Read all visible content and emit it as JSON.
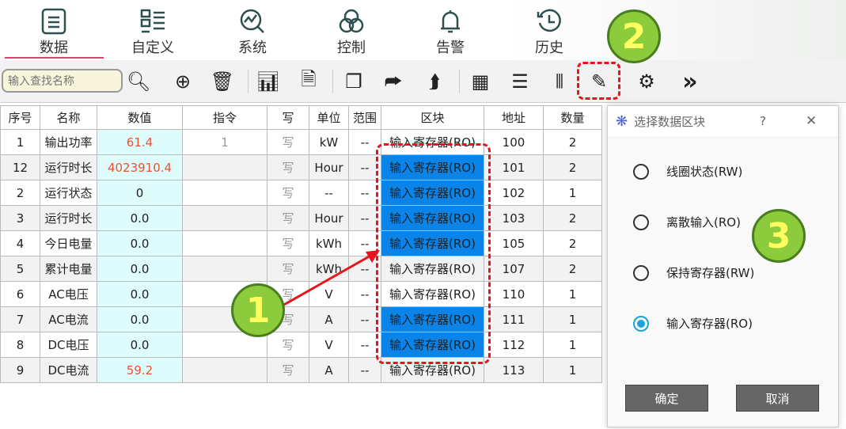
{
  "nav": [
    {
      "label": "数据",
      "icon": "document-icon"
    },
    {
      "label": "自定义",
      "icon": "list-icon"
    },
    {
      "label": "系统",
      "icon": "chart-search-icon"
    },
    {
      "label": "控制",
      "icon": "control-icon"
    },
    {
      "label": "告警",
      "icon": "bell-icon"
    },
    {
      "label": "历史",
      "icon": "history-icon"
    }
  ],
  "search": {
    "placeholder": "输入查找名称"
  },
  "table": {
    "headers": [
      "序号",
      "名称",
      "数值",
      "指令",
      "写",
      "单位",
      "范围",
      "区块",
      "地址",
      "数量"
    ],
    "rows": [
      [
        "1",
        "输出功率",
        "61.4",
        "1",
        "写",
        "kW",
        "--",
        "输入寄存器(RO)",
        "100",
        "2"
      ],
      [
        "12",
        "运行时长",
        "4023910.4",
        "",
        "写",
        "Hour",
        "--",
        "输入寄存器(RO)",
        "101",
        "2"
      ],
      [
        "2",
        "运行状态",
        "0",
        "",
        "写",
        "--",
        "--",
        "输入寄存器(RO)",
        "102",
        "1"
      ],
      [
        "3",
        "运行时长",
        "0.0",
        "",
        "写",
        "Hour",
        "--",
        "输入寄存器(RO)",
        "103",
        "2"
      ],
      [
        "4",
        "今日电量",
        "0.0",
        "",
        "写",
        "kWh",
        "--",
        "输入寄存器(RO)",
        "105",
        "2"
      ],
      [
        "5",
        "累计电量",
        "0.0",
        "",
        "写",
        "kWh",
        "--",
        "输入寄存器(RO)",
        "107",
        "2"
      ],
      [
        "6",
        "AC电压",
        "0.0",
        "",
        "写",
        "V",
        "--",
        "输入寄存器(RO)",
        "110",
        "1"
      ],
      [
        "7",
        "AC电流",
        "0.0",
        "",
        "写",
        "A",
        "--",
        "输入寄存器(RO)",
        "111",
        "1"
      ],
      [
        "8",
        "DC电压",
        "0.0",
        "",
        "写",
        "V",
        "--",
        "输入寄存器(RO)",
        "112",
        "1"
      ],
      [
        "9",
        "DC电流",
        "59.2",
        "",
        "写",
        "A",
        "--",
        "输入寄存器(RO)",
        "113",
        "1"
      ]
    ],
    "selected_block_rows": [
      1,
      2,
      3,
      4,
      7,
      8
    ],
    "red_value_rows": [
      0,
      1,
      9
    ]
  },
  "dialog": {
    "title": "选择数据区块",
    "help": "?",
    "close": "✕",
    "options": [
      {
        "label": "线圈状态(RW)",
        "checked": false
      },
      {
        "label": "离散输入(RO)",
        "checked": false
      },
      {
        "label": "保持寄存器(RW)",
        "checked": false
      },
      {
        "label": "输入寄存器(RO)",
        "checked": true
      }
    ],
    "ok": "确定",
    "cancel": "取消"
  },
  "badges": [
    "1",
    "2",
    "3"
  ],
  "colors": {
    "selected": "#0a84e8",
    "annotation": "#e8141c",
    "badge": "#8ccb3c",
    "value_red": "#f0502a"
  }
}
